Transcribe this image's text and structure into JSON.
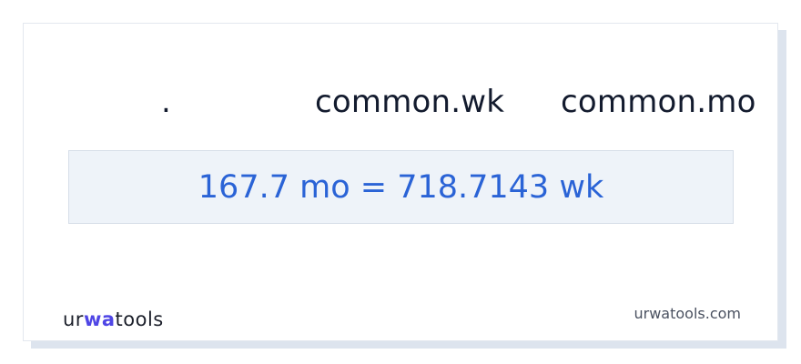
{
  "header": {
    "separator": ".",
    "unit_from": "common.wk",
    "unit_to": "common.mo"
  },
  "result": {
    "text": "167.7 mo = 718.7143 wk"
  },
  "footer": {
    "logo_part1": "ur",
    "logo_part2": "wa",
    "logo_part3": "too",
    "logo_part4": "ls",
    "site": "urwatools.com"
  },
  "colors": {
    "accent": "#2a63d6",
    "logo_accent": "#4f46e5",
    "result_bg": "#eef3f9",
    "text": "#131b2e"
  }
}
